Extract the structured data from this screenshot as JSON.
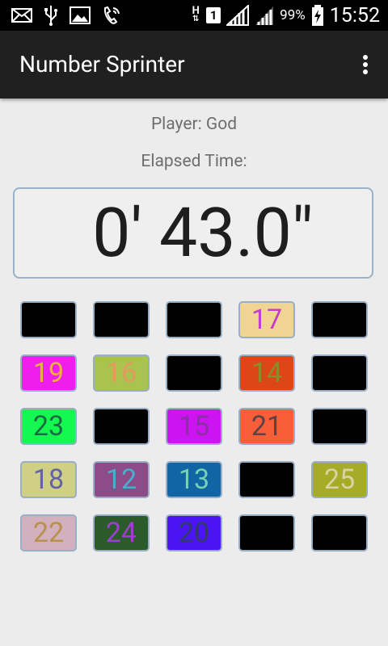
{
  "status_bar": {
    "icons_left": [
      "mail-icon",
      "usb-icon",
      "image-icon",
      "phone-wifi-icon"
    ],
    "network_type": "H",
    "sim_slot": "1",
    "battery_percent": "99%",
    "time": "15:52"
  },
  "app_bar": {
    "title": "Number Sprinter"
  },
  "player_label": "Player: God",
  "elapsed_label": "Elapsed Time:",
  "timer": "0' 43.0\"",
  "tiles": [
    {
      "text": "",
      "bg": "#000000",
      "fg": "#000000"
    },
    {
      "text": "",
      "bg": "#000000",
      "fg": "#000000"
    },
    {
      "text": "",
      "bg": "#000000",
      "fg": "#000000"
    },
    {
      "text": "17",
      "bg": "#efd591",
      "fg": "#c43cc8"
    },
    {
      "text": "",
      "bg": "#000000",
      "fg": "#000000"
    },
    {
      "text": "19",
      "bg": "#ee1fee",
      "fg": "#ecae45"
    },
    {
      "text": "16",
      "bg": "#a9c44e",
      "fg": "#e59a5d"
    },
    {
      "text": "",
      "bg": "#000000",
      "fg": "#000000"
    },
    {
      "text": "14",
      "bg": "#dd4717",
      "fg": "#8c8c2a"
    },
    {
      "text": "",
      "bg": "#000000",
      "fg": "#000000"
    },
    {
      "text": "23",
      "bg": "#14f84f",
      "fg": "#1c6a45"
    },
    {
      "text": "",
      "bg": "#000000",
      "fg": "#000000"
    },
    {
      "text": "15",
      "bg": "#cc14f1",
      "fg": "#8c2ea5"
    },
    {
      "text": "21",
      "bg": "#f85e38",
      "fg": "#5c4247"
    },
    {
      "text": "",
      "bg": "#000000",
      "fg": "#000000"
    },
    {
      "text": "18",
      "bg": "#cfd086",
      "fg": "#6561a5"
    },
    {
      "text": "12",
      "bg": "#8c4c88",
      "fg": "#4aaecf"
    },
    {
      "text": "13",
      "bg": "#1265a4",
      "fg": "#76d3ad"
    },
    {
      "text": "",
      "bg": "#000000",
      "fg": "#000000"
    },
    {
      "text": "25",
      "bg": "#a6ab28",
      "fg": "#dbd3a1"
    },
    {
      "text": "22",
      "bg": "#d2b0bd",
      "fg": "#b8914a"
    },
    {
      "text": "24",
      "bg": "#2c5b2b",
      "fg": "#9a3fcf"
    },
    {
      "text": "20",
      "bg": "#4b14f4",
      "fg": "#2f3a6a"
    },
    {
      "text": "",
      "bg": "#000000",
      "fg": "#000000"
    },
    {
      "text": "",
      "bg": "#000000",
      "fg": "#000000"
    }
  ]
}
